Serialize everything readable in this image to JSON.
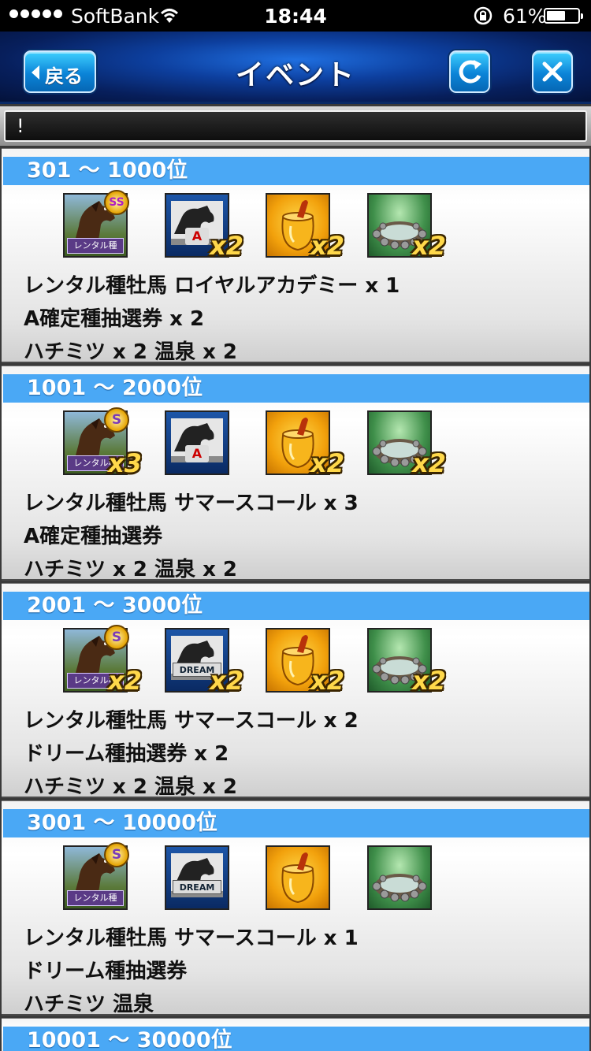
{
  "status_bar": {
    "carrier": "SoftBank",
    "time": "18:44",
    "battery_percent": "61%",
    "battery_level": 0.61
  },
  "header": {
    "back_label": "戻る",
    "title": "イベント"
  },
  "notice": {
    "text": "!"
  },
  "rewards": [
    {
      "rank": "301 〜 1000位",
      "grade": "SS",
      "icon_multipliers": [
        "",
        "x2",
        "x2",
        "x2"
      ],
      "ticket_mark": "A",
      "lines": [
        "レンタル種牡馬 ロイヤルアカデミー x 1",
        "A確定種抽選券 x 2",
        "ハチミツ x 2 温泉 x 2"
      ]
    },
    {
      "rank": "1001 〜 2000位",
      "grade": "S",
      "icon_multipliers": [
        "x3",
        "",
        "x2",
        "x2"
      ],
      "ticket_mark": "A",
      "lines": [
        "レンタル種牡馬 サマースコール x 3",
        "A確定種抽選券",
        "ハチミツ x 2 温泉 x 2"
      ]
    },
    {
      "rank": "2001 〜 3000位",
      "grade": "S",
      "icon_multipliers": [
        "x2",
        "x2",
        "x2",
        "x2"
      ],
      "ticket_mark": "DREAM",
      "lines": [
        "レンタル種牡馬 サマースコール x 2",
        "ドリーム種抽選券 x 2",
        "ハチミツ x 2 温泉 x 2"
      ]
    },
    {
      "rank": "3001 〜 10000位",
      "grade": "S",
      "icon_multipliers": [
        "",
        "",
        "",
        ""
      ],
      "ticket_mark": "DREAM",
      "lines": [
        "レンタル種牡馬 サマースコール x 1",
        "ドリーム種抽選券",
        "ハチミツ 温泉"
      ]
    },
    {
      "rank": "10001 〜 30000位"
    }
  ],
  "rental_tag": "レンタル種"
}
